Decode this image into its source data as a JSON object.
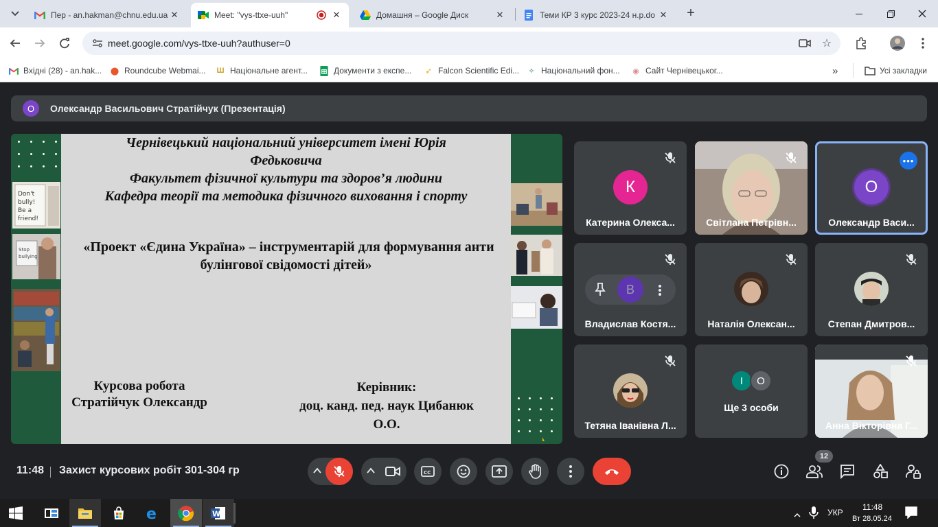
{
  "browser": {
    "tabs": [
      {
        "title": "Пер - an.hakman@chnu.edu.ua",
        "icon": "gmail-icon"
      },
      {
        "title": "Meet: \"vys-ttxe-uuh\"",
        "icon": "meet-icon",
        "active": true
      },
      {
        "title": "Домашня – Google Диск",
        "icon": "drive-icon"
      },
      {
        "title": "Теми КР 3 курс 2023-24 н.р.do",
        "icon": "docs-icon"
      }
    ],
    "url": "meet.google.com/vys-ttxe-uuh?authuser=0",
    "bookmarks": [
      {
        "label": "Вхідні (28) - an.hak...",
        "icon": "gmail-icon"
      },
      {
        "label": "Roundcube Webmai...",
        "icon": "roundcube-icon"
      },
      {
        "label": "Національне агент...",
        "icon": "trident-icon"
      },
      {
        "label": "Документи з експе...",
        "icon": "sheets-icon"
      },
      {
        "label": "Falcon Scientific Edi...",
        "icon": "falcon-icon"
      },
      {
        "label": "Національний фон...",
        "icon": "fund-icon"
      },
      {
        "label": "Сайт Чернівецьког...",
        "icon": "site-icon"
      }
    ],
    "all_bookmarks": "Усі закладки"
  },
  "meet": {
    "presenter_initial": "О",
    "presenter_label": "Олександр Васильович Стратійчук (Презентація)",
    "slide": {
      "header_lines": [
        "Чернівецький національний університет імені Юрія",
        "Федьковича",
        "Факультет фізичної культури та здоров’я людини",
        "Кафедра теорії та методика фізичного виховання і спорту"
      ],
      "title_lines": [
        "«Проект «Єдина Україна» – інструментарій для формування анти",
        "булінгової свідомості дітей»"
      ],
      "left_lines": [
        "Курсова робота",
        "Стратійчук Олександр"
      ],
      "right_lines": [
        "Керівник:",
        "доц. канд. пед. наук Цибанюк",
        "О.О."
      ]
    },
    "participants": [
      {
        "name": "Катерина Олекса...",
        "initial": "К",
        "color": "#e52592",
        "type": "letter",
        "muted": true
      },
      {
        "name": "Світлана Петрівн...",
        "type": "video",
        "muted": true
      },
      {
        "name": "Олександр Васи...",
        "initial": "О",
        "color": "#7b45c7",
        "type": "letter",
        "speaking": true
      },
      {
        "name": "Владислав Костя...",
        "initial": "В",
        "color": "#5e35b1",
        "type": "hover",
        "muted": true
      },
      {
        "name": "Наталія Олексан...",
        "type": "photo",
        "muted": true
      },
      {
        "name": "Степан Дмитров...",
        "type": "photo",
        "muted": true
      },
      {
        "name": "Тетяна Іванівна Л...",
        "type": "photo",
        "muted": true
      },
      {
        "name": "Ще 3 особи",
        "initials": [
          "І",
          "О"
        ],
        "type": "group"
      },
      {
        "name": "Анна Вікторівна Г...",
        "type": "video",
        "muted": true
      }
    ],
    "time": "11:48",
    "meeting_title": "Захист курсових робіт 301-304 гр",
    "people_count": "12"
  },
  "taskbar": {
    "lang": "УКР",
    "clock_time": "11:48",
    "clock_date": "Вт 28.05.24"
  },
  "colors": {
    "end_call": "#ea4335",
    "accent": "#1a73e8",
    "slide_green": "#1f5a3c"
  }
}
